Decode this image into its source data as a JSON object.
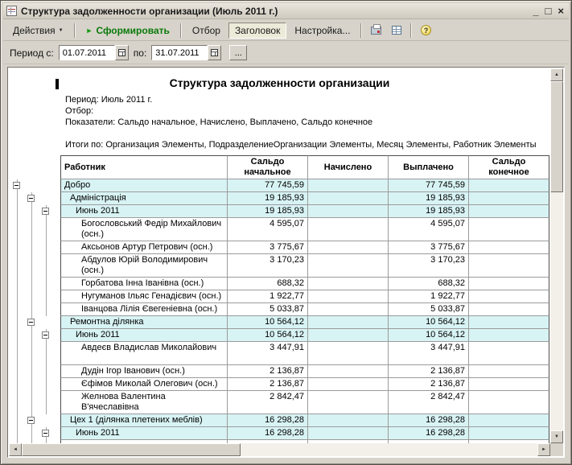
{
  "window": {
    "title": "Структура задолженности организации (Июль 2011 г.)",
    "controls": {
      "minimize": "_",
      "maximize": "□",
      "close": "×"
    }
  },
  "icons": {
    "dropdown": "▼",
    "play": "►",
    "scroll_up": "▲",
    "scroll_down": "▼",
    "scroll_left": "◄",
    "scroll_right": "►"
  },
  "toolbar": {
    "actions": "Действия",
    "generate": "Сформировать",
    "filter": "Отбор",
    "header_btn": "Заголовок",
    "settings": "Настройка...",
    "help": "?"
  },
  "period": {
    "from_label": "Период с:",
    "from_value": "01.07.2011",
    "to_label": "по:",
    "to_value": "31.07.2011",
    "more": "..."
  },
  "report": {
    "title": "Структура задолженности организации",
    "meta": [
      "Период: Июль 2011 г.",
      "Отбор:",
      "Показатели:  Сальдо начальное, Начислено, Выплачено, Сальдо конечное"
    ],
    "totals_line": "Итоги по:  Организация Элементы, ПодразделениеОрганизации Элементы, Месяц Элементы, Работник Элементы"
  },
  "table": {
    "headers": {
      "worker": "Работник",
      "saldo_start": "Сальдо начальное",
      "accrued": "Начислено",
      "paid": "Выплачено",
      "saldo_end": "Сальдо конечное"
    },
    "rows": [
      {
        "name": "Добро",
        "level": 0,
        "group": true,
        "start": "77 745,59",
        "accrued": "",
        "paid": "77 745,59",
        "end": "",
        "lines": [
          0
        ],
        "box": 0
      },
      {
        "name": "Адміністрація",
        "level": 1,
        "group": true,
        "start": "19 185,93",
        "accrued": "",
        "paid": "19 185,93",
        "end": "",
        "lines": [
          0,
          1
        ],
        "box": 1
      },
      {
        "name": "Июнь 2011",
        "level": 2,
        "group": true,
        "start": "19 185,93",
        "accrued": "",
        "paid": "19 185,93",
        "end": "",
        "lines": [
          0,
          1,
          2
        ],
        "box": 2
      },
      {
        "name": "Богословський Федір Михайлович (осн.)",
        "level": 3,
        "group": false,
        "start": "4 595,07",
        "accrued": "",
        "paid": "4 595,07",
        "end": "",
        "lines": [
          0,
          1,
          2
        ],
        "tall": true
      },
      {
        "name": "Аксьонов Артур Петрович (осн.)",
        "level": 3,
        "group": false,
        "start": "3 775,67",
        "accrued": "",
        "paid": "3 775,67",
        "end": "",
        "lines": [
          0,
          1,
          2
        ]
      },
      {
        "name": "Абдулов Юрій Володимирович (осн.)",
        "level": 3,
        "group": false,
        "start": "3 170,23",
        "accrued": "",
        "paid": "3 170,23",
        "end": "",
        "lines": [
          0,
          1,
          2
        ],
        "tall": true
      },
      {
        "name": "Горбатова Інна Іванівна (осн.)",
        "level": 3,
        "group": false,
        "start": "688,32",
        "accrued": "",
        "paid": "688,32",
        "end": "",
        "lines": [
          0,
          1,
          2
        ]
      },
      {
        "name": "Нугуманов Ільяс Генадієвич (осн.)",
        "level": 3,
        "group": false,
        "start": "1 922,77",
        "accrued": "",
        "paid": "1 922,77",
        "end": "",
        "lines": [
          0,
          1,
          2
        ]
      },
      {
        "name": "Іванцова Лілія Євегеніевна (осн.)",
        "level": 3,
        "group": false,
        "start": "5 033,87",
        "accrued": "",
        "paid": "5 033,87",
        "end": "",
        "lines": [
          0,
          1,
          2
        ]
      },
      {
        "name": "Ремонтна ділянка",
        "level": 1,
        "group": true,
        "start": "10 564,12",
        "accrued": "",
        "paid": "10 564,12",
        "end": "",
        "lines": [
          0,
          1
        ],
        "box": 1
      },
      {
        "name": "Июнь 2011",
        "level": 2,
        "group": true,
        "start": "10 564,12",
        "accrued": "",
        "paid": "10 564,12",
        "end": "",
        "lines": [
          0,
          1,
          2
        ],
        "box": 2
      },
      {
        "name": "Авдеєв Владислав Миколайович",
        "level": 3,
        "group": false,
        "start": "3 447,91",
        "accrued": "",
        "paid": "3 447,91",
        "end": "",
        "lines": [
          0,
          1,
          2
        ],
        "tall": true
      },
      {
        "name": "Дудін Ігор Іванович (осн.)",
        "level": 3,
        "group": false,
        "start": "2 136,87",
        "accrued": "",
        "paid": "2 136,87",
        "end": "",
        "lines": [
          0,
          1,
          2
        ]
      },
      {
        "name": "Єфімов Миколай Олегович (осн.)",
        "level": 3,
        "group": false,
        "start": "2 136,87",
        "accrued": "",
        "paid": "2 136,87",
        "end": "",
        "lines": [
          0,
          1,
          2
        ]
      },
      {
        "name": "Желнова Валентина В'ячеславівна",
        "level": 3,
        "group": false,
        "start": "2 842,47",
        "accrued": "",
        "paid": "2 842,47",
        "end": "",
        "lines": [
          0,
          1,
          2
        ],
        "tall": true
      },
      {
        "name": "Цех 1 (ділянка плетених меблів)",
        "level": 1,
        "group": true,
        "start": "16 298,28",
        "accrued": "",
        "paid": "16 298,28",
        "end": "",
        "lines": [
          0,
          1
        ],
        "box": 1
      },
      {
        "name": "Июнь 2011",
        "level": 2,
        "group": true,
        "start": "16 298,28",
        "accrued": "",
        "paid": "16 298,28",
        "end": "",
        "lines": [
          0,
          1,
          2
        ],
        "box": 2
      },
      {
        "name": "",
        "level": 3,
        "group": false,
        "start": "",
        "accrued": "",
        "paid": "",
        "end": "",
        "lines": [
          0,
          1,
          2
        ]
      }
    ]
  },
  "colors": {
    "window_bg": "#d7d3ca",
    "group_row_bg": "#d8f3f4",
    "generate_green": "#0a7a0a",
    "grid_line": "#9b9b9b"
  }
}
